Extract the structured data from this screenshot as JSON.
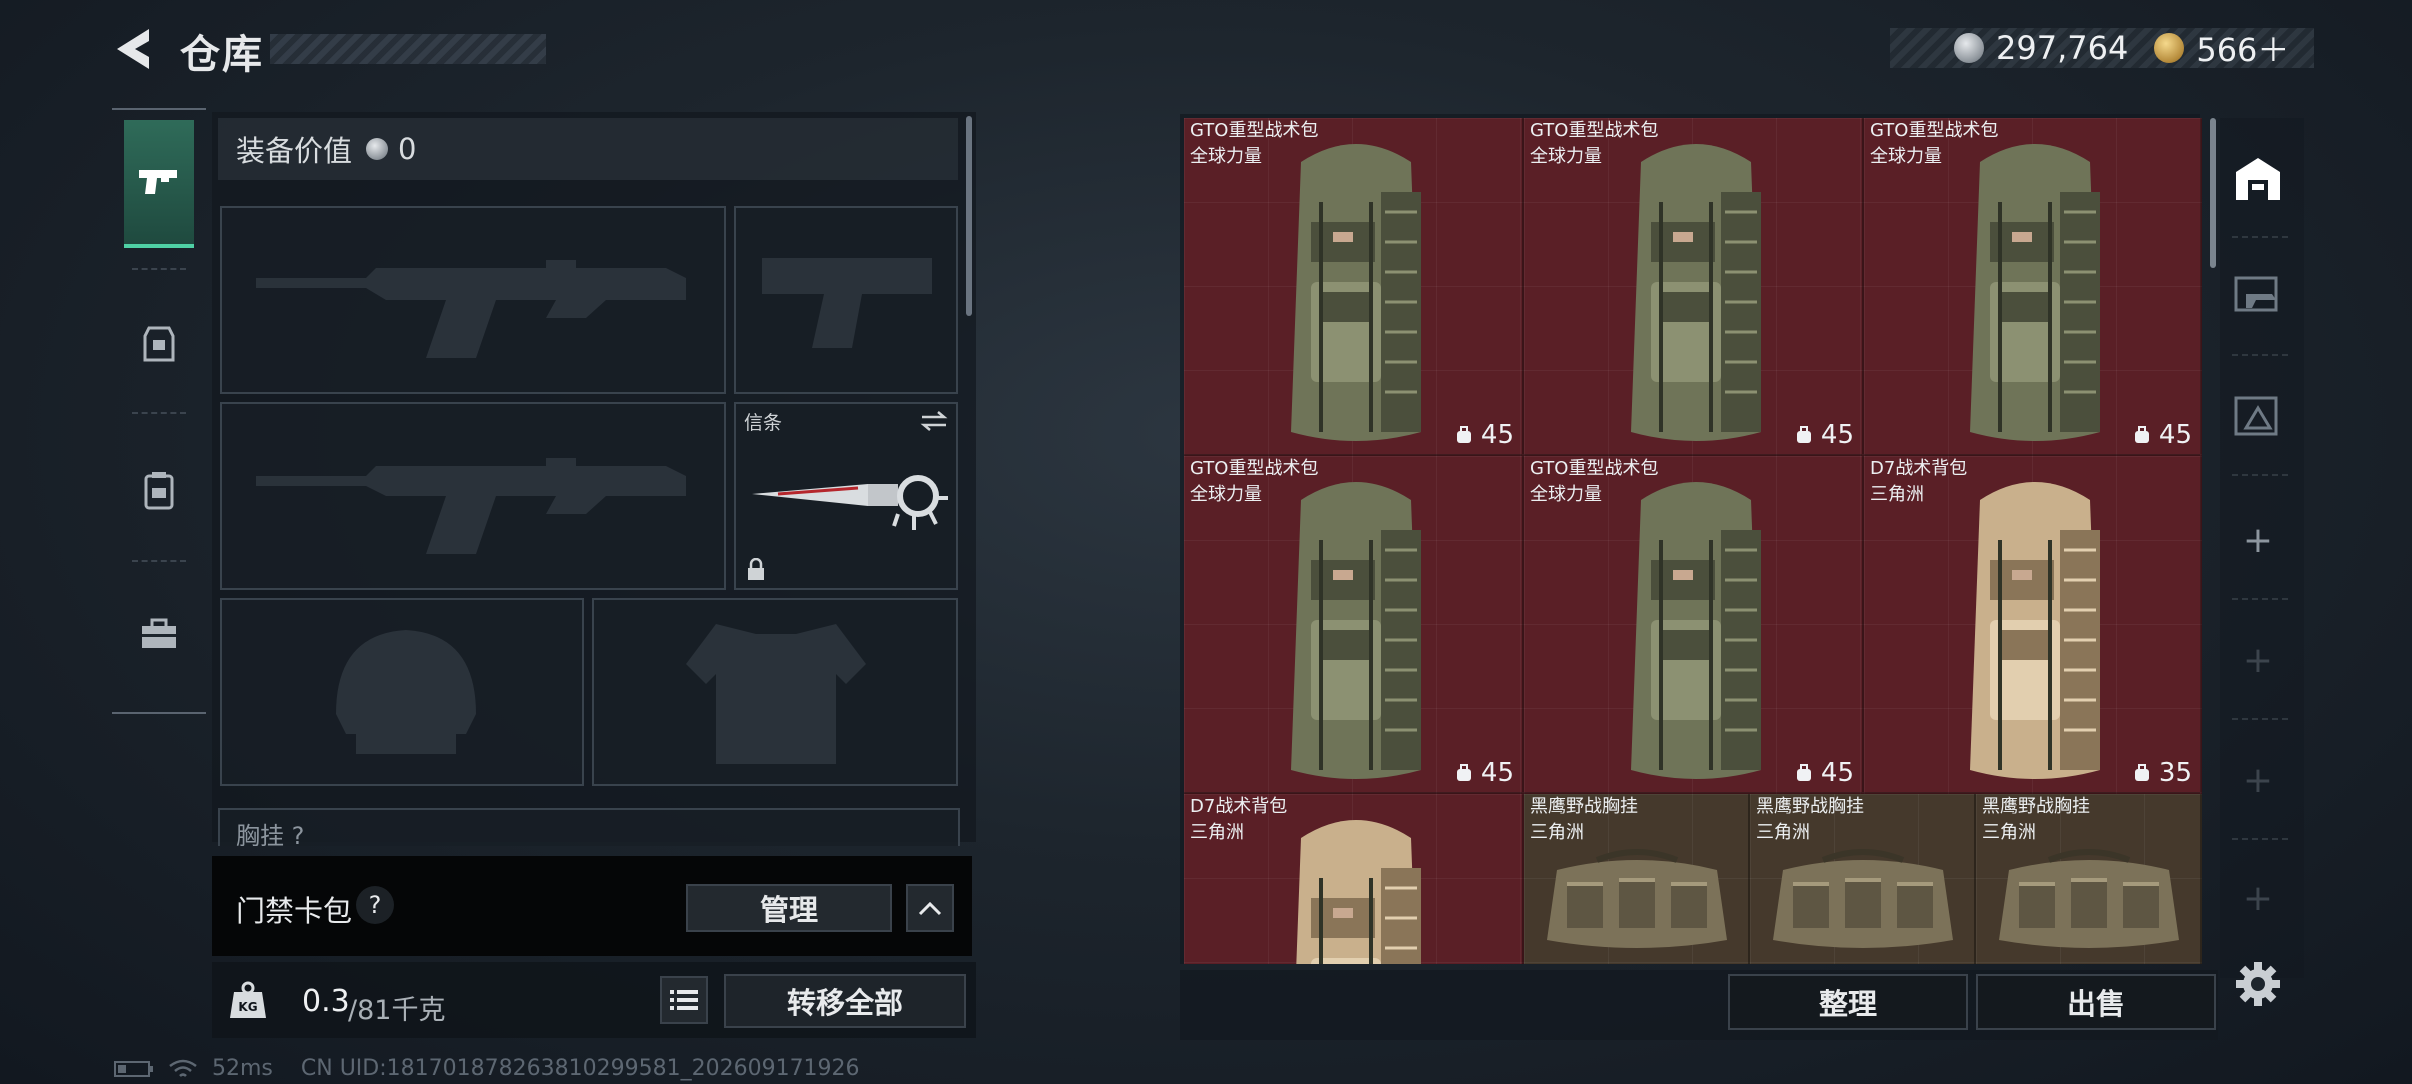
{
  "header": {
    "title": "仓库",
    "currency_silver": "297,764",
    "currency_gold": "566＋"
  },
  "loadout": {
    "value_label": "装备价值",
    "value": "0",
    "melee_label": "信条",
    "chest_label": "胸挂 ?"
  },
  "keycard": {
    "label": "门禁卡包",
    "help": "?",
    "manage": "管理"
  },
  "weight": {
    "current": "0.3",
    "max": "/81千克"
  },
  "actions": {
    "transfer_all": "转移全部",
    "sort": "整理",
    "sell": "出售"
  },
  "stash": {
    "items": [
      {
        "name": "GTO重型战术包",
        "sub": "全球力量",
        "cap": "45",
        "bg": "red",
        "kind": "gto"
      },
      {
        "name": "GTO重型战术包",
        "sub": "全球力量",
        "cap": "45",
        "bg": "red",
        "kind": "gto"
      },
      {
        "name": "GTO重型战术包",
        "sub": "全球力量",
        "cap": "45",
        "bg": "red",
        "kind": "gto"
      },
      {
        "name": "GTO重型战术包",
        "sub": "全球力量",
        "cap": "45",
        "bg": "red",
        "kind": "gto"
      },
      {
        "name": "GTO重型战术包",
        "sub": "全球力量",
        "cap": "45",
        "bg": "red",
        "kind": "gto"
      },
      {
        "name": "D7战术背包",
        "sub": "三角洲",
        "cap": "35",
        "bg": "red",
        "kind": "d7"
      },
      {
        "name": "D7战术背包",
        "sub": "三角洲",
        "cap": "",
        "bg": "red",
        "kind": "d7"
      },
      {
        "name": "黑鹰野战胸挂",
        "sub": "三角洲",
        "cap": "",
        "bg": "brown",
        "kind": "rig"
      },
      {
        "name": "黑鹰野战胸挂",
        "sub": "三角洲",
        "cap": "",
        "bg": "brown",
        "kind": "rig"
      },
      {
        "name": "黑鹰野战胸挂",
        "sub": "三角洲",
        "cap": "",
        "bg": "brown",
        "kind": "rig"
      }
    ]
  },
  "status": {
    "ping": "52ms",
    "uid": "CN UID:18170187826381029958​1_202609171926"
  },
  "colors": {
    "accent": "#4fd1a5",
    "item_red": "#5a1f26",
    "item_brown": "#45392c"
  }
}
